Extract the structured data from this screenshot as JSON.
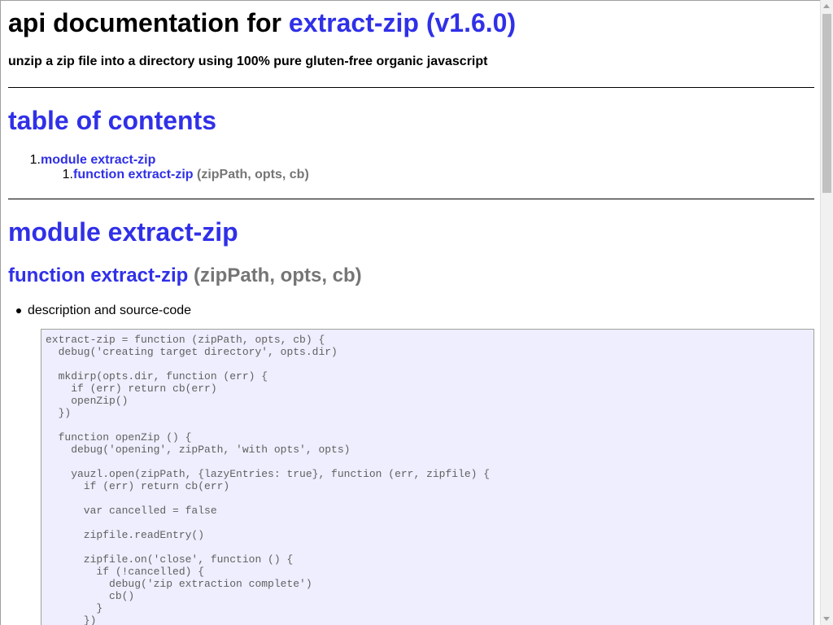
{
  "header": {
    "title_prefix": "api documentation for ",
    "title_link": "extract-zip (v1.6.0)",
    "subtitle": "unzip a zip file into a directory using 100% pure gluten-free organic javascript"
  },
  "toc": {
    "heading": "table of contents",
    "items": [
      {
        "number": "1.",
        "label": "module extract-zip",
        "children": [
          {
            "number": "1.",
            "label": "function extract-zip",
            "signature": " (zipPath, opts, cb)"
          }
        ]
      }
    ]
  },
  "module": {
    "heading": "module extract-zip",
    "function": {
      "label": "function extract-zip",
      "signature": " (zipPath, opts, cb)",
      "bullet": "description and source-code",
      "source": "extract-zip = function (zipPath, opts, cb) {\n  debug('creating target directory', opts.dir)\n\n  mkdirp(opts.dir, function (err) {\n    if (err) return cb(err)\n    openZip()\n  })\n\n  function openZip () {\n    debug('opening', zipPath, 'with opts', opts)\n\n    yauzl.open(zipPath, {lazyEntries: true}, function (err, zipfile) {\n      if (err) return cb(err)\n\n      var cancelled = false\n\n      zipfile.readEntry()\n\n      zipfile.on('close', function () {\n        if (!cancelled) {\n          debug('zip extraction complete')\n          cb()\n        }\n      })"
    }
  },
  "colors": {
    "link": "#3030e8",
    "muted": "#757575",
    "code_background": "#eeeeff",
    "code_text": "#606060"
  }
}
